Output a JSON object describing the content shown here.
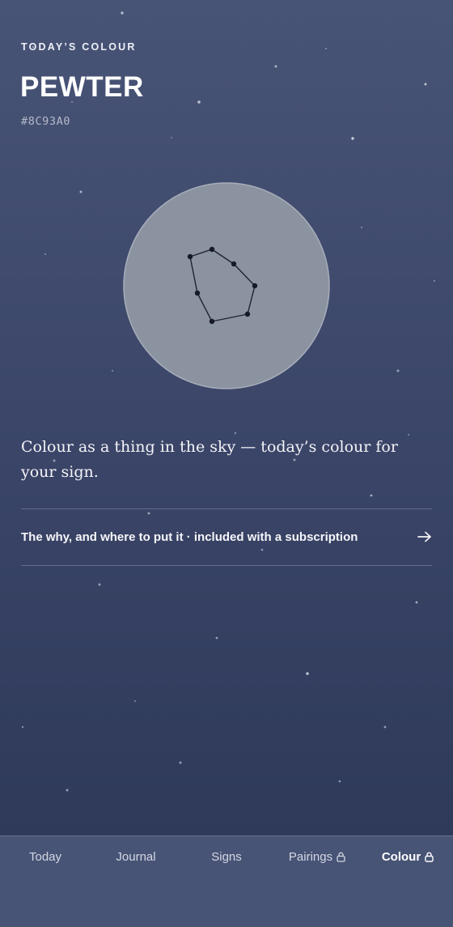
{
  "header": {
    "eyebrow": "TODAY’S COLOUR",
    "colour_name": "PEWTER",
    "hex": "#8C93A0"
  },
  "swatch": {
    "fill": "#8C93A0",
    "icon": "constellation-icon"
  },
  "tagline": "Colour as a thing in the sky — today’s colour for your sign.",
  "subscribe": {
    "label": "The why, and where to put it · included with a subscription",
    "icon": "arrow-right-icon"
  },
  "tabs": [
    {
      "label": "Today",
      "locked": false,
      "active": false
    },
    {
      "label": "Journal",
      "locked": false,
      "active": false
    },
    {
      "label": "Signs",
      "locked": false,
      "active": false
    },
    {
      "label": "Pairings",
      "locked": true,
      "active": false
    },
    {
      "label": "Colour",
      "locked": true,
      "active": true
    }
  ],
  "colors": {
    "background_top": "#485476",
    "background_bottom": "#2c3656",
    "text": "#f2f3f7"
  }
}
